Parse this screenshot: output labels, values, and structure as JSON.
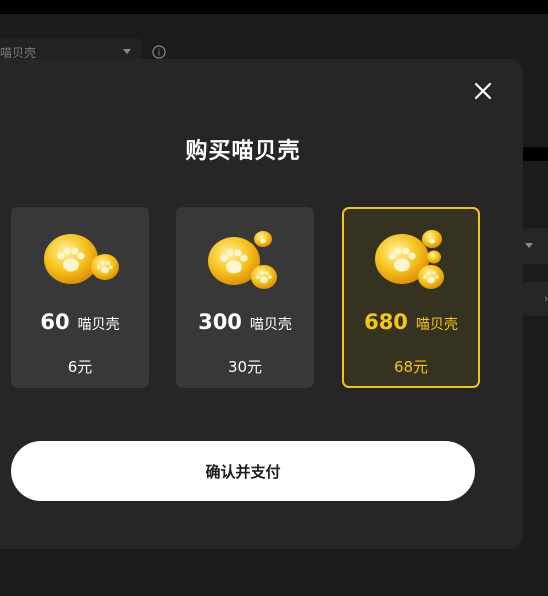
{
  "background": {
    "select_value": "喵贝壳",
    "info_glyph": "i"
  },
  "modal": {
    "title": "购买喵贝壳",
    "close_icon": "close-icon",
    "options": [
      {
        "amount": "60",
        "unit": "喵贝壳",
        "price": "6元",
        "selected": false
      },
      {
        "amount": "300",
        "unit": "喵贝壳",
        "price": "30元",
        "selected": false
      },
      {
        "amount": "680",
        "unit": "喵贝壳",
        "price": "68元",
        "selected": true
      }
    ],
    "confirm_label": "确认并支付"
  },
  "colors": {
    "accent": "#f5c518",
    "modal_bg": "#262626",
    "card_bg": "#383838",
    "selected_card_bg": "#35321f"
  }
}
